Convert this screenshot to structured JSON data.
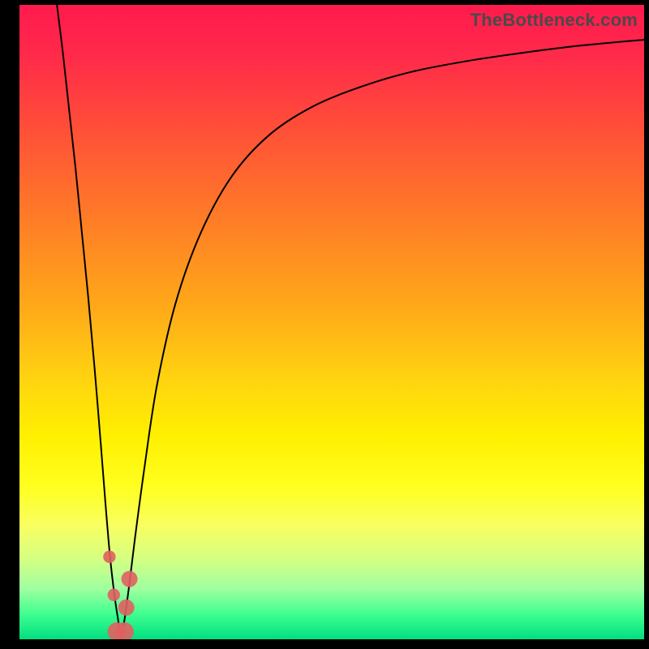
{
  "watermark": "TheBottleneck.com",
  "chart_data": {
    "type": "line",
    "title": "",
    "xlabel": "",
    "ylabel": "",
    "xlim": [
      0,
      100
    ],
    "ylim": [
      0,
      100
    ],
    "grid": false,
    "legend": false,
    "series": [
      {
        "name": "left-branch",
        "x": [
          6,
          7,
          8,
          9,
          10,
          11,
          12,
          13,
          13.8,
          14.5,
          15.2,
          15.8,
          16.3
        ],
        "y": [
          100,
          92,
          83,
          74,
          64,
          54,
          43,
          31,
          21,
          13,
          7,
          3,
          0
        ]
      },
      {
        "name": "right-branch",
        "x": [
          16.3,
          16.8,
          17.5,
          18.5,
          20,
          22,
          25,
          29,
          34,
          40,
          47,
          55,
          63,
          72,
          81,
          90,
          100
        ],
        "y": [
          0,
          3,
          8,
          16,
          27,
          40,
          53,
          64,
          73,
          79.5,
          84,
          87.2,
          89.5,
          91.2,
          92.5,
          93.6,
          94.5
        ]
      }
    ],
    "markers": [
      {
        "name": "marker-left-upper",
        "x": 14.4,
        "y": 13.0,
        "r": 1.0
      },
      {
        "name": "marker-left-lower",
        "x": 15.1,
        "y": 7.0,
        "r": 1.0
      },
      {
        "name": "marker-right-upper",
        "x": 17.6,
        "y": 9.5,
        "r": 1.3
      },
      {
        "name": "marker-right-lower",
        "x": 17.1,
        "y": 5.0,
        "r": 1.3
      },
      {
        "name": "marker-valley-a",
        "x": 15.6,
        "y": 1.2,
        "r": 1.5
      },
      {
        "name": "marker-valley-b",
        "x": 16.8,
        "y": 1.2,
        "r": 1.5
      }
    ],
    "marker_color": "#e06060",
    "curve_color": "#000000",
    "curve_width": 2.0
  }
}
